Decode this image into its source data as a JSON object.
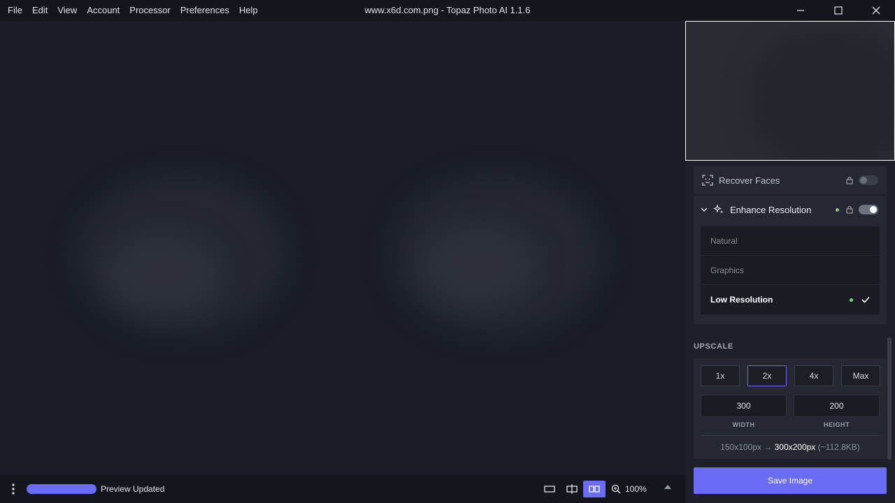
{
  "menu": [
    "File",
    "Edit",
    "View",
    "Account",
    "Processor",
    "Preferences",
    "Help"
  ],
  "window": {
    "title": "www.x6d.com.png - Topaz Photo AI 1.1.6"
  },
  "status": {
    "text": "Preview Updated",
    "progress": 1.0,
    "zoom": "100%"
  },
  "sidebar": {
    "recover_faces": {
      "label": "Recover Faces",
      "enabled": false
    },
    "enhance_resolution": {
      "label": "Enhance Resolution",
      "enabled": true,
      "models": [
        "Natural",
        "Graphics",
        "Low Resolution"
      ],
      "selected": "Low Resolution"
    },
    "upscale": {
      "title": "UPSCALE",
      "scales": [
        "1x",
        "2x",
        "4x",
        "Max"
      ],
      "active_scale": "2x",
      "width": "300",
      "height": "200",
      "width_label": "WIDTH",
      "height_label": "HEIGHT",
      "original": "150x100px",
      "arrow": "→",
      "output": "300x200px",
      "size": "(~112.8KB)"
    },
    "save_label": "Save Image"
  },
  "colors": {
    "accent": "#6a6cf6",
    "active_dot": "#7cd57c",
    "panel": "#252833",
    "background": "#1a1d26"
  }
}
